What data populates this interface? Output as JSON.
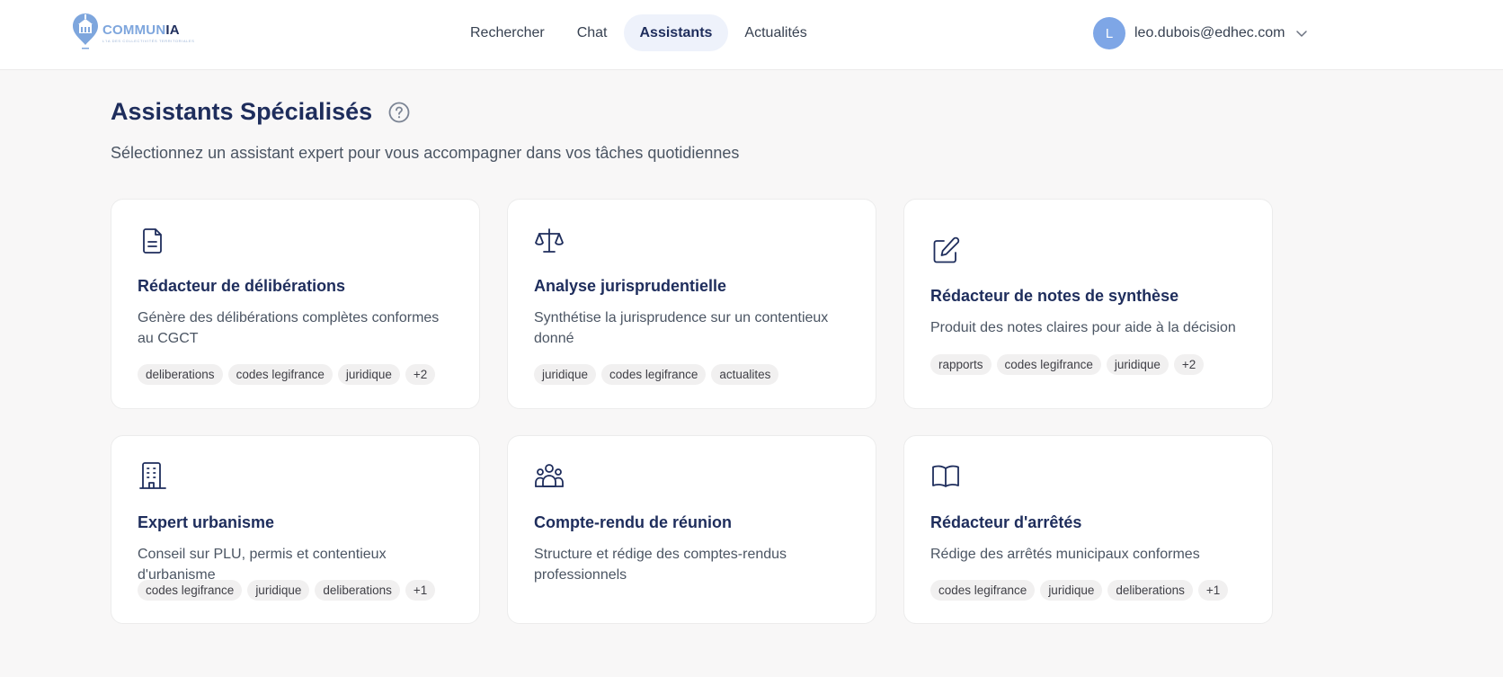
{
  "brand": {
    "name_part1": "COMMUN",
    "name_part2": "IA",
    "tagline": "L'IA DES COLLECTIVITÉS TERRITORIALES"
  },
  "nav": {
    "items": [
      {
        "label": "Rechercher"
      },
      {
        "label": "Chat"
      },
      {
        "label": "Assistants",
        "active": true
      },
      {
        "label": "Actualités"
      }
    ]
  },
  "user": {
    "initial": "L",
    "email": "leo.dubois@edhec.com"
  },
  "page": {
    "title": "Assistants Spécialisés",
    "subtitle": "Sélectionnez un assistant expert pour vous accompagner dans vos tâches quotidiennes"
  },
  "assistants": [
    {
      "icon": "document-icon",
      "title": "Rédacteur de délibérations",
      "description": "Génère des délibérations complètes conformes au CGCT",
      "tags": [
        "deliberations",
        "codes legifrance",
        "juridique",
        "+2"
      ]
    },
    {
      "icon": "scale-icon",
      "title": "Analyse jurisprudentielle",
      "description": "Synthétise la jurisprudence sur un contentieux donné",
      "tags": [
        "juridique",
        "codes legifrance",
        "actualites"
      ]
    },
    {
      "icon": "edit-icon",
      "title": "Rédacteur de notes de synthèse",
      "description": "Produit des notes claires pour aide à la décision",
      "tags": [
        "rapports",
        "codes legifrance",
        "juridique",
        "+2"
      ]
    },
    {
      "icon": "building-icon",
      "title": "Expert urbanisme",
      "description": "Conseil sur PLU, permis et contentieux d'urbanisme",
      "tags": [
        "codes legifrance",
        "juridique",
        "deliberations",
        "+1"
      ]
    },
    {
      "icon": "users-icon",
      "title": "Compte-rendu de réunion",
      "description": "Structure et rédige des comptes-rendus professionnels",
      "tags": []
    },
    {
      "icon": "book-icon",
      "title": "Rédacteur d'arrêtés",
      "description": "Rédige des arrêtés municipaux conformes",
      "tags": [
        "codes legifrance",
        "juridique",
        "deliberations",
        "+1"
      ]
    }
  ],
  "colors": {
    "primary": "#1e2d5c",
    "accent": "#7ea6e6",
    "background": "#f8f7f7"
  }
}
